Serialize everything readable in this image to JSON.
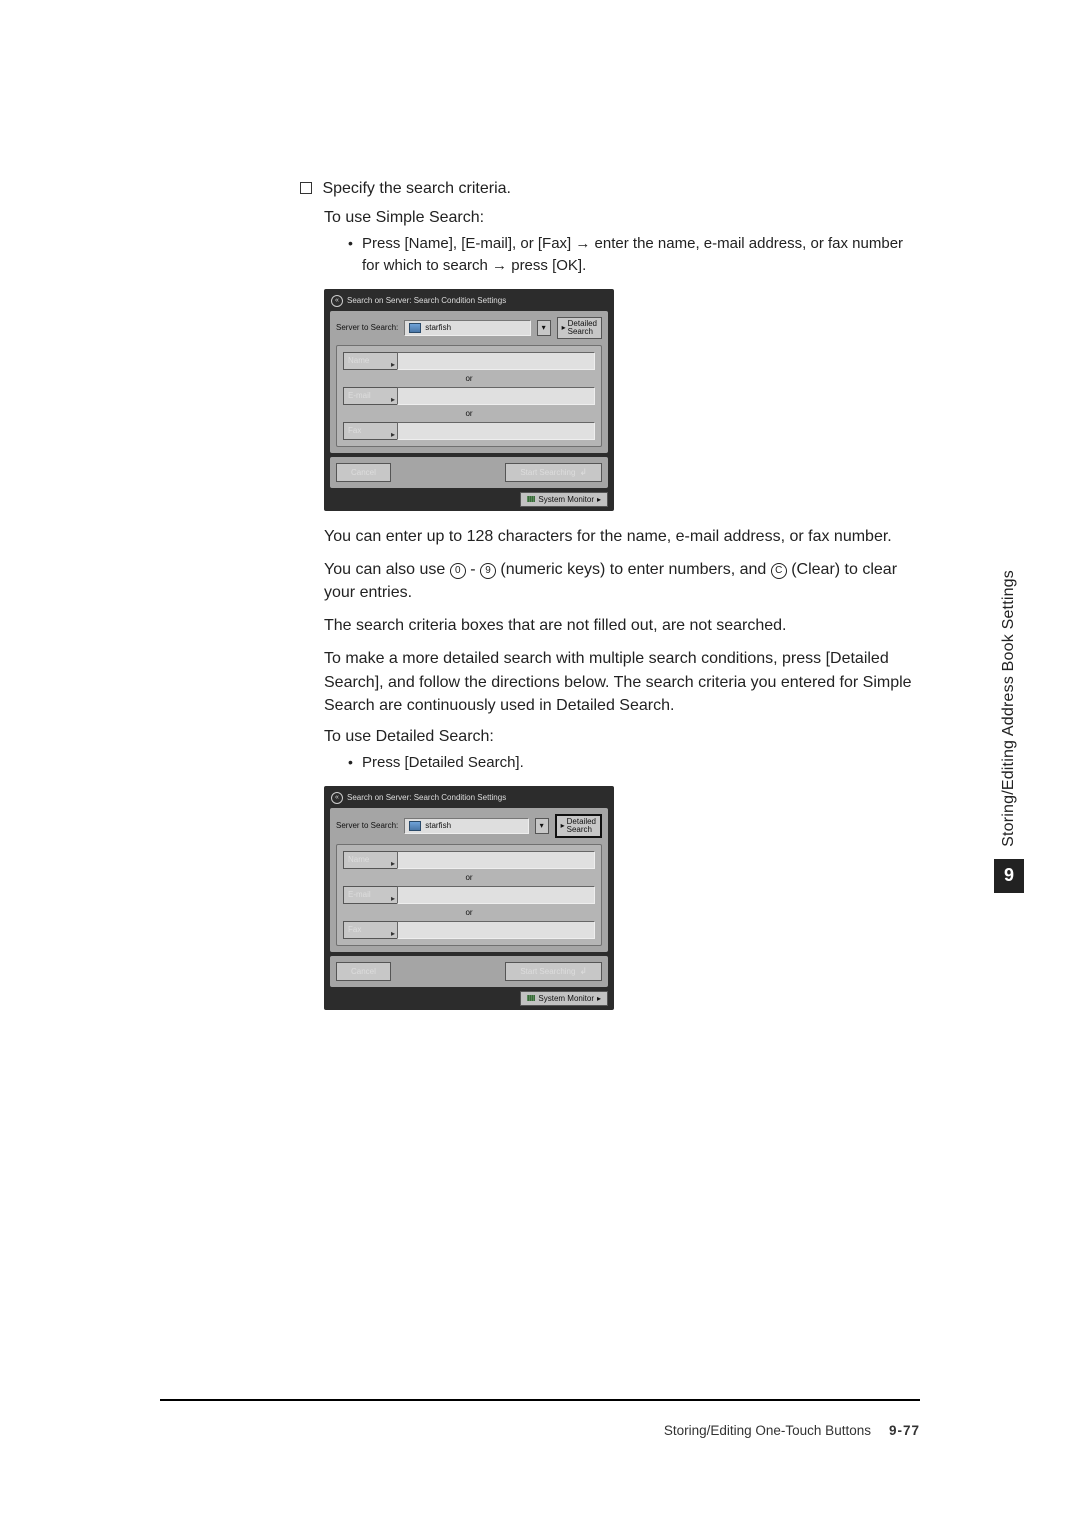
{
  "checkbox_title": "Specify the search criteria.",
  "simple_intro": "To use Simple Search:",
  "simple_bullet": "Press [Name], [E-mail], or [Fax] → enter the name, e-mail address, or fax number for which to search → press [OK].",
  "lcd": {
    "title": "Search on Server: Search Condition Settings",
    "server_label": "Server to Search:",
    "server_value": "starfish",
    "detailed_btn_line1": "Detailed",
    "detailed_btn_line2": "Search",
    "name": "Name",
    "email": "E-mail",
    "fax": "Fax",
    "or": "or",
    "cancel": "Cancel",
    "start": "Start Searching",
    "sysmon": "System Monitor"
  },
  "p_chars": "You can enter up to 128 characters for the name, e-mail address, or fax number.",
  "p_keysA": "You can also use ",
  "p_keysB": " - ",
  "p_keysC": " (numeric keys) to enter numbers, and ",
  "p_keysD": " (Clear) to clear your entries.",
  "key_0": "0",
  "key_9": "9",
  "key_c": "C",
  "p_notfilled": "The search criteria boxes that are not filled out, are not searched.",
  "p_detailed_expl": "To make a more detailed search with multiple search conditions, press [Detailed Search], and follow the directions below. The search criteria you entered for Simple Search are continuously used in Detailed Search.",
  "det_intro": "To use Detailed Search:",
  "det_bullet": "Press [Detailed Search].",
  "side_label": "Storing/Editing Address Book Settings",
  "chapter": "9",
  "footer_label": "Storing/Editing One-Touch Buttons",
  "footer_page": "9-77"
}
